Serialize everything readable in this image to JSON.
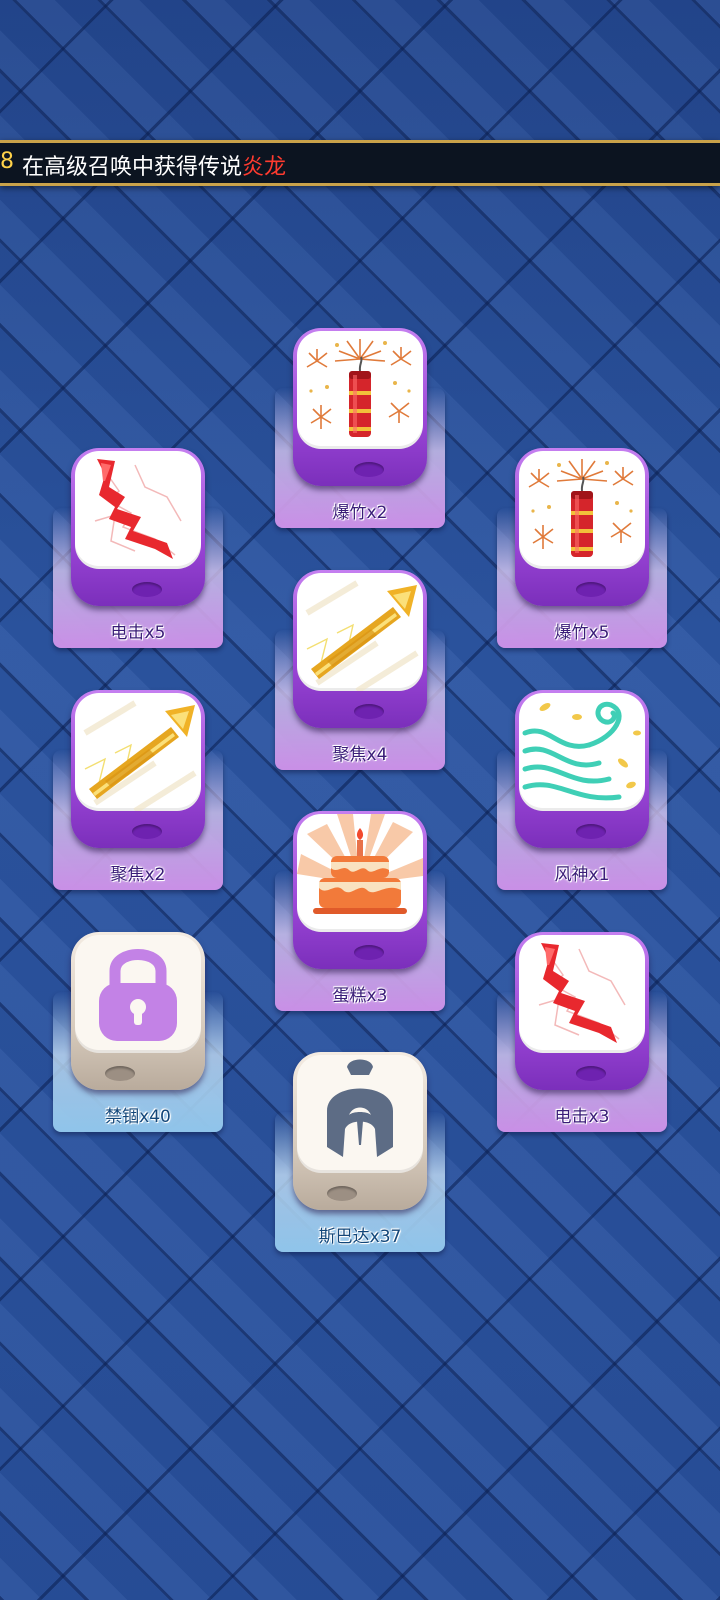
{
  "ticker": {
    "prefix": "8",
    "message": "在高级召唤中获得传说",
    "highlight": "炎龙"
  },
  "cards": [
    {
      "id": "firecracker-1",
      "label": "爆竹x2",
      "theme": "purple",
      "icon": "firecracker-icon"
    },
    {
      "id": "lightning-1",
      "label": "电击x5",
      "theme": "purple",
      "icon": "lightning-icon"
    },
    {
      "id": "firecracker-2",
      "label": "爆竹x5",
      "theme": "purple",
      "icon": "firecracker-icon"
    },
    {
      "id": "focus-1",
      "label": "聚焦x4",
      "theme": "purple",
      "icon": "focus-beam-icon"
    },
    {
      "id": "focus-2",
      "label": "聚焦x2",
      "theme": "purple",
      "icon": "focus-beam-icon"
    },
    {
      "id": "wind-god",
      "label": "风神x1",
      "theme": "purple",
      "icon": "wind-swirl-icon"
    },
    {
      "id": "cake",
      "label": "蛋糕x3",
      "theme": "purple",
      "icon": "cake-icon"
    },
    {
      "id": "lock",
      "label": "禁锢x40",
      "theme": "white",
      "icon": "padlock-icon"
    },
    {
      "id": "lightning-2",
      "label": "电击x3",
      "theme": "purple",
      "icon": "lightning-icon"
    },
    {
      "id": "spartan",
      "label": "斯巴达x37",
      "theme": "white",
      "icon": "spartan-helmet-icon"
    }
  ],
  "colors": {
    "ticker_highlight": "#ff3b2f",
    "ticker_prefix": "#ffd24a",
    "purple_block": "#9a45d6",
    "white_block": "#d7cbbd",
    "background": "#2a4f97"
  }
}
